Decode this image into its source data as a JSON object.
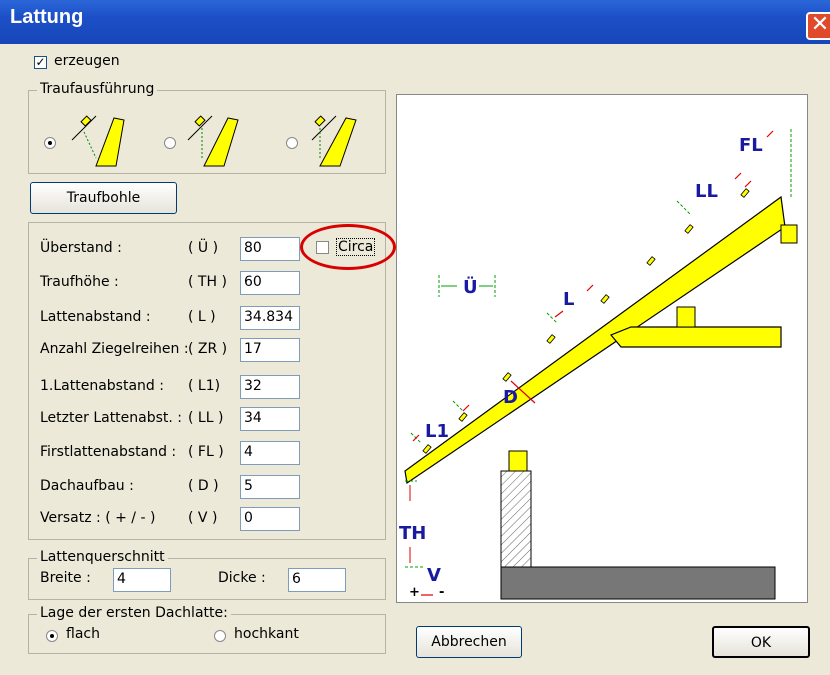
{
  "window": {
    "title": "Lattung",
    "close_glyph": "✕"
  },
  "erzeugen": {
    "label": "erzeugen",
    "checked": true
  },
  "traufausfuehrung": {
    "label": "Traufausführung",
    "selected": 0
  },
  "traufbohle_button": "Traufbohle",
  "fields": [
    {
      "label": "Überstand :",
      "abbr": "( Ü )",
      "value": "80"
    },
    {
      "label": "Traufhöhe :",
      "abbr": "( TH )",
      "value": "60"
    },
    {
      "label": "Lattenabstand :",
      "abbr": "( L )",
      "value": "34.834"
    },
    {
      "label": "Anzahl Ziegelreihen :",
      "abbr": "( ZR )",
      "value": "17"
    },
    {
      "label": "1.Lattenabstand :",
      "abbr": "( L1)",
      "value": "32"
    },
    {
      "label": "Letzter Lattenabst. :",
      "abbr": "( LL )",
      "value": "34"
    },
    {
      "label": "Firstlattenabstand :",
      "abbr": "( FL )",
      "value": "4"
    },
    {
      "label": "Dachaufbau :",
      "abbr": "( D )",
      "value": "5"
    },
    {
      "label": "Versatz : ( + / - )",
      "abbr": "( V )",
      "value": "0"
    }
  ],
  "circa": {
    "label": "Circa",
    "checked": false
  },
  "lattenquerschnitt": {
    "label": "Lattenquerschnitt",
    "breite_label": "Breite :",
    "breite_value": "4",
    "dicke_label": "Dicke :",
    "dicke_value": "6"
  },
  "lage": {
    "label": "Lage der ersten Dachlatte:",
    "options": [
      "flach",
      "hochkant"
    ],
    "selected": 0
  },
  "buttons": {
    "cancel": "Abbrechen",
    "ok": "OK"
  },
  "diagram_labels": {
    "FL": "FL",
    "LL": "LL",
    "U": "Ü",
    "L": "L",
    "D": "D",
    "L1": "L1",
    "TH": "TH",
    "V": "V",
    "plus": "+",
    "minus": "-"
  },
  "colors": {
    "beam": "#ffff00",
    "dim_label": "#1a1aa0",
    "dim_line": "#00a000",
    "arrow": "#e00000",
    "floor": "#777777"
  }
}
